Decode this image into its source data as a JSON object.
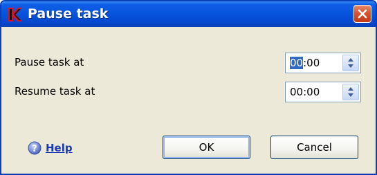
{
  "window": {
    "title": "Pause task",
    "app_icon": "kaspersky-k-icon",
    "close_icon": "close-x-icon"
  },
  "fields": [
    {
      "label": "Pause task at",
      "hours": "00",
      "separator": ":",
      "minutes": "00",
      "hours_selected": true
    },
    {
      "label": "Resume task at",
      "hours": "00",
      "separator": ":",
      "minutes": "00",
      "hours_selected": false
    }
  ],
  "footer": {
    "help_label": "Help",
    "help_icon": "help-question-icon",
    "ok_label": "OK",
    "cancel_label": "Cancel"
  },
  "colors": {
    "titlebar": "#0855dd",
    "close_button": "#d9532f",
    "dialog_background": "#ece9d8",
    "link": "#1b3bb4",
    "selection": "#316ac5"
  }
}
